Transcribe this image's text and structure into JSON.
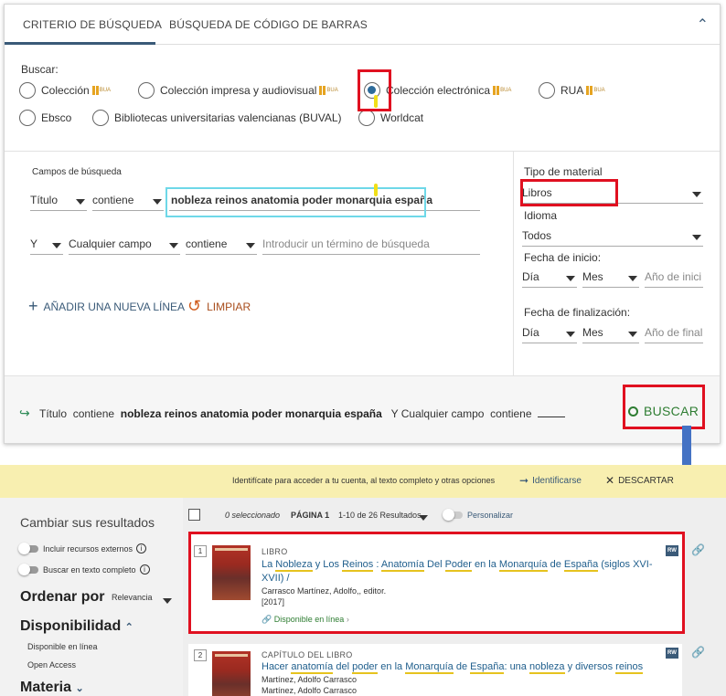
{
  "tabs": {
    "criteria": "CRITERIO DE BÚSQUEDA",
    "barcode": "BÚSQUEDA DE CÓDIGO DE BARRAS"
  },
  "scope": {
    "label": "Buscar:",
    "options": [
      "Colección",
      "Colección impresa y audiovisual",
      "Colección electrónica",
      "RUA",
      "Ebsco",
      "Bibliotecas universitarias valencianas (BUVAL)",
      "Worldcat"
    ],
    "selected": "Colección electrónica",
    "bua_badge": "BUA"
  },
  "fields": {
    "label": "Campos de búsqueda",
    "row1": {
      "field": "Título",
      "operator": "contiene",
      "value": "nobleza reinos anatomia poder monarquia españa"
    },
    "row2": {
      "bool": "Y",
      "field": "Cualquier campo",
      "operator": "contiene",
      "placeholder": "Introducir un término de búsqueda"
    },
    "add_line": "AÑADIR UNA NUEVA LÍNEA",
    "clear": "LIMPIAR"
  },
  "filters": {
    "material_label": "Tipo de material",
    "material_value": "Libros",
    "language_label": "Idioma",
    "language_value": "Todos",
    "start_label": "Fecha de inicio:",
    "end_label": "Fecha de finalización:",
    "day": "Día",
    "month": "Mes",
    "start_year_ph": "Año de inici",
    "end_year_ph": "Año de final"
  },
  "summary": {
    "field1": "Título",
    "op1": "contiene",
    "term1": "nobleza reinos anatomia poder monarquia españa",
    "bool": "Y",
    "field2": "Cualquier campo",
    "op2": "contiene",
    "search_button": "BUSCAR"
  },
  "banner": {
    "text": "Identifícate para acceder a tu cuenta, al texto completo y otras opciones",
    "login": "Identificarse",
    "dismiss": "DESCARTAR"
  },
  "sidebar": {
    "refine": "Cambiar sus resultados",
    "toggle_external": "Incluir recursos externos",
    "toggle_fulltext": "Buscar en texto completo",
    "sort_label": "Ordenar por",
    "sort_value": "Relevancia",
    "availability": "Disponibilidad",
    "avail_online": "Disponible en línea",
    "avail_open": "Open Access",
    "subject": "Materia"
  },
  "results_bar": {
    "selected": "0 seleccionado",
    "page": "PÁGINA 1",
    "range": "1-10 de 26 Resultados",
    "personalize": "Personalizar"
  },
  "results": [
    {
      "num": "1",
      "type": "LIBRO",
      "title_parts": [
        "La ",
        "Nobleza",
        " y Los ",
        "Reinos",
        " : ",
        "Anatomía",
        " Del ",
        "Poder",
        " en la ",
        "Monarquía",
        " de ",
        "España",
        " (siglos XVI-XVII) /"
      ],
      "author": "Carrasco Martínez, Adolfo,, editor.",
      "year": "[2017]",
      "availability": "Disponible en línea",
      "badge": "RW"
    },
    {
      "num": "2",
      "type": "CAPÍTULO DEL LIBRO",
      "title_parts": [
        "Hacer ",
        "anatomía",
        " del ",
        "poder",
        " en la ",
        "Monarquía",
        " de ",
        "España",
        ": una ",
        "nobleza",
        " y diversos ",
        "reinos"
      ],
      "author": "Martínez, Adolfo Carrasco",
      "author2": "Martínez, Adolfo Carrasco",
      "badge": "RW"
    }
  ],
  "colors": {
    "accent": "#3a5a78",
    "green": "#2e7d32",
    "annotation_red": "#e01020",
    "banner": "#f8efb0"
  }
}
